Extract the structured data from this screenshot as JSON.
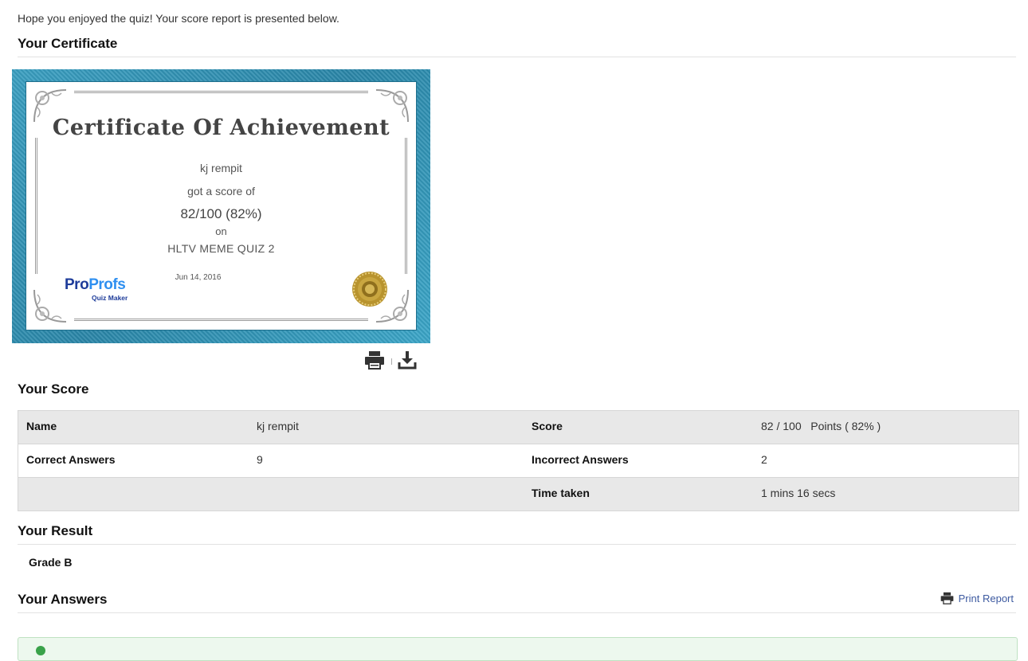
{
  "intro_text": "Hope you enjoyed the quiz! Your score report is presented below.",
  "sections": {
    "certificate": "Your Certificate",
    "score": "Your Score",
    "result": "Your Result",
    "answers": "Your Answers"
  },
  "certificate": {
    "title": "Certificate Of Achievement",
    "name": "kj rempit",
    "got_score_text": "got a score of",
    "score_text": "82/100 (82%)",
    "on_text": "on",
    "quiz_name": "HLTV MEME QUIZ 2",
    "date": "Jun 14, 2016",
    "logo": {
      "brand_part1": "Pro",
      "brand_part2": "Profs",
      "tagline": "Quiz Maker"
    },
    "frame_color": "#2f94b8"
  },
  "certificate_tools": {
    "print_icon": "printer-icon",
    "download_icon": "download-icon"
  },
  "score_table": {
    "rows": [
      {
        "label1": "Name",
        "value1": "kj rempit",
        "label2": "Score",
        "value2": "82 / 100   Points ( 82% )"
      },
      {
        "label1": "Correct Answers",
        "value1": "9",
        "label2": "Incorrect Answers",
        "value2": "2"
      },
      {
        "label1": "",
        "value1": "",
        "label2": "Time taken",
        "value2": "1 mins 16 secs"
      }
    ]
  },
  "result": {
    "grade": "Grade B"
  },
  "answers": {
    "print_report_label": "Print Report",
    "print_icon": "printer-icon"
  },
  "colors": {
    "link": "#3d5aa0",
    "success_bg": "#edf8ee",
    "table_shade": "#e8e8e8"
  }
}
